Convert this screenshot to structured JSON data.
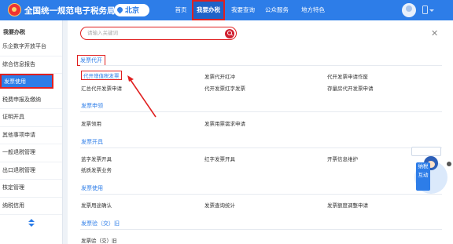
{
  "header": {
    "title": "全国统一规范电子税务局",
    "region": "北京",
    "nav": {
      "home": "首页",
      "ban": "我要办税",
      "cx": "我要查询",
      "gz": "公众服务",
      "df": "地方特色"
    }
  },
  "sidebar": {
    "title": "我要办税",
    "items": [
      "乐企数字开放平台",
      "综合信息报告",
      "发票使用",
      "税费申报及缴纳",
      "证明开具",
      "其他事项申请",
      "一般退税管理",
      "出口退税管理",
      "核定管理",
      "纳税信用"
    ],
    "active_index": 2
  },
  "search": {
    "placeholder": "请输入关键词"
  },
  "sections": {
    "fpdk": {
      "title": "发票代开",
      "links": [
        "代开增值税发票",
        "发票代开红冲",
        "代开发票申请作废",
        "汇总代开发票申请",
        "代开发票红字发票",
        "存量房代开发票申请"
      ]
    },
    "fpsl": {
      "title": "发票申领",
      "links": [
        "发票领用",
        "发票用票需求申请"
      ]
    },
    "fpkj": {
      "title": "发票开具",
      "links": [
        "蓝字发票开具",
        "红字发票开具",
        "开票信息维护",
        "纸质发票业务"
      ]
    },
    "fpsy": {
      "title": "发票使用",
      "links": [
        "发票用途确认",
        "发票查询统计",
        "发票额度调整申请"
      ]
    },
    "fpyj": {
      "title": "发票验（交）旧",
      "links": [
        "发票验（交）旧"
      ]
    }
  },
  "assistant": {
    "badge": "纳税互动"
  },
  "colors": {
    "primary": "#2d7de8",
    "highlight": "#e02020"
  }
}
